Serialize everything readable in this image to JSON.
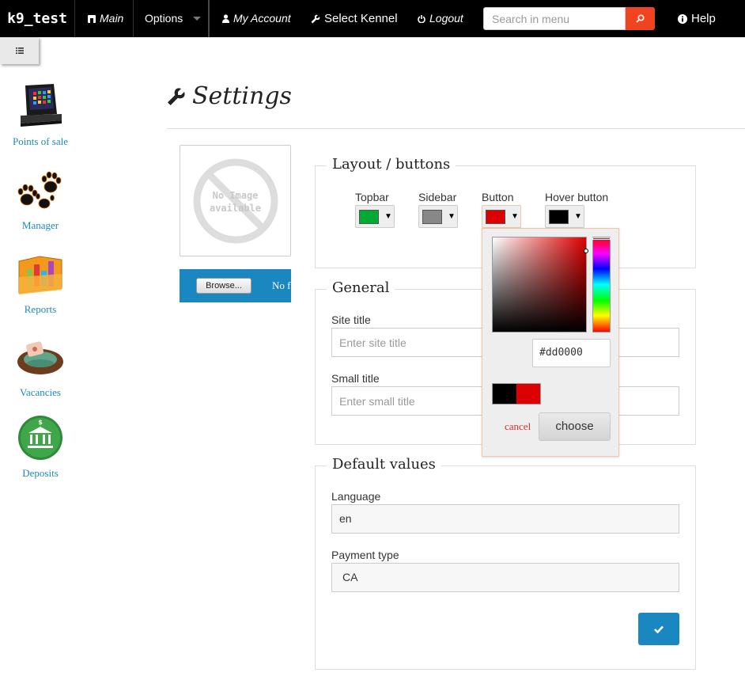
{
  "topbar": {
    "brand": "k9_test",
    "main_label": "Main",
    "options_label": "Options",
    "account_label": "My Account",
    "kennel_label": "Select Kennel",
    "logout_label": "Logout",
    "search_placeholder": "Search in menu",
    "help_label": "Help"
  },
  "sidebar": {
    "items": [
      {
        "label": "Points of sale",
        "icon": "cash-register-icon"
      },
      {
        "label": "Manager",
        "icon": "paw-prints-icon"
      },
      {
        "label": "Reports",
        "icon": "bar-chart-folder-icon"
      },
      {
        "label": "Vacancies",
        "icon": "dog-bed-icon"
      },
      {
        "label": "Deposits",
        "icon": "bank-icon"
      }
    ]
  },
  "page": {
    "title": "Settings",
    "image_placeholder": [
      "No Image",
      "available"
    ],
    "browse_label": "Browse...",
    "no_file_text": "No f"
  },
  "layout_section": {
    "legend": "Layout / buttons",
    "colors": [
      {
        "label": "Topbar",
        "value": "#00aa33"
      },
      {
        "label": "Sidebar",
        "value": "#888888"
      },
      {
        "label": "Button",
        "value": "#dd0000"
      },
      {
        "label": "Hover button",
        "value": "#000000"
      }
    ]
  },
  "color_picker": {
    "hex_value": "#dd0000",
    "previous_color": "#000000",
    "new_color": "#dd0000",
    "cancel_label": "cancel",
    "choose_label": "choose"
  },
  "general_section": {
    "legend": "General",
    "site_title_label": "Site title",
    "site_title_placeholder": "Enter site title",
    "small_title_label": "Small title",
    "small_title_placeholder": "Enter small title"
  },
  "defaults_section": {
    "legend": "Default values",
    "language_label": "Language",
    "language_value": "en",
    "payment_label": "Payment type",
    "payment_value": "CA"
  },
  "colors": {
    "accent_blue": "#1a87c0",
    "search_button": "#f0431f",
    "link_blue": "#1d8ab8"
  }
}
